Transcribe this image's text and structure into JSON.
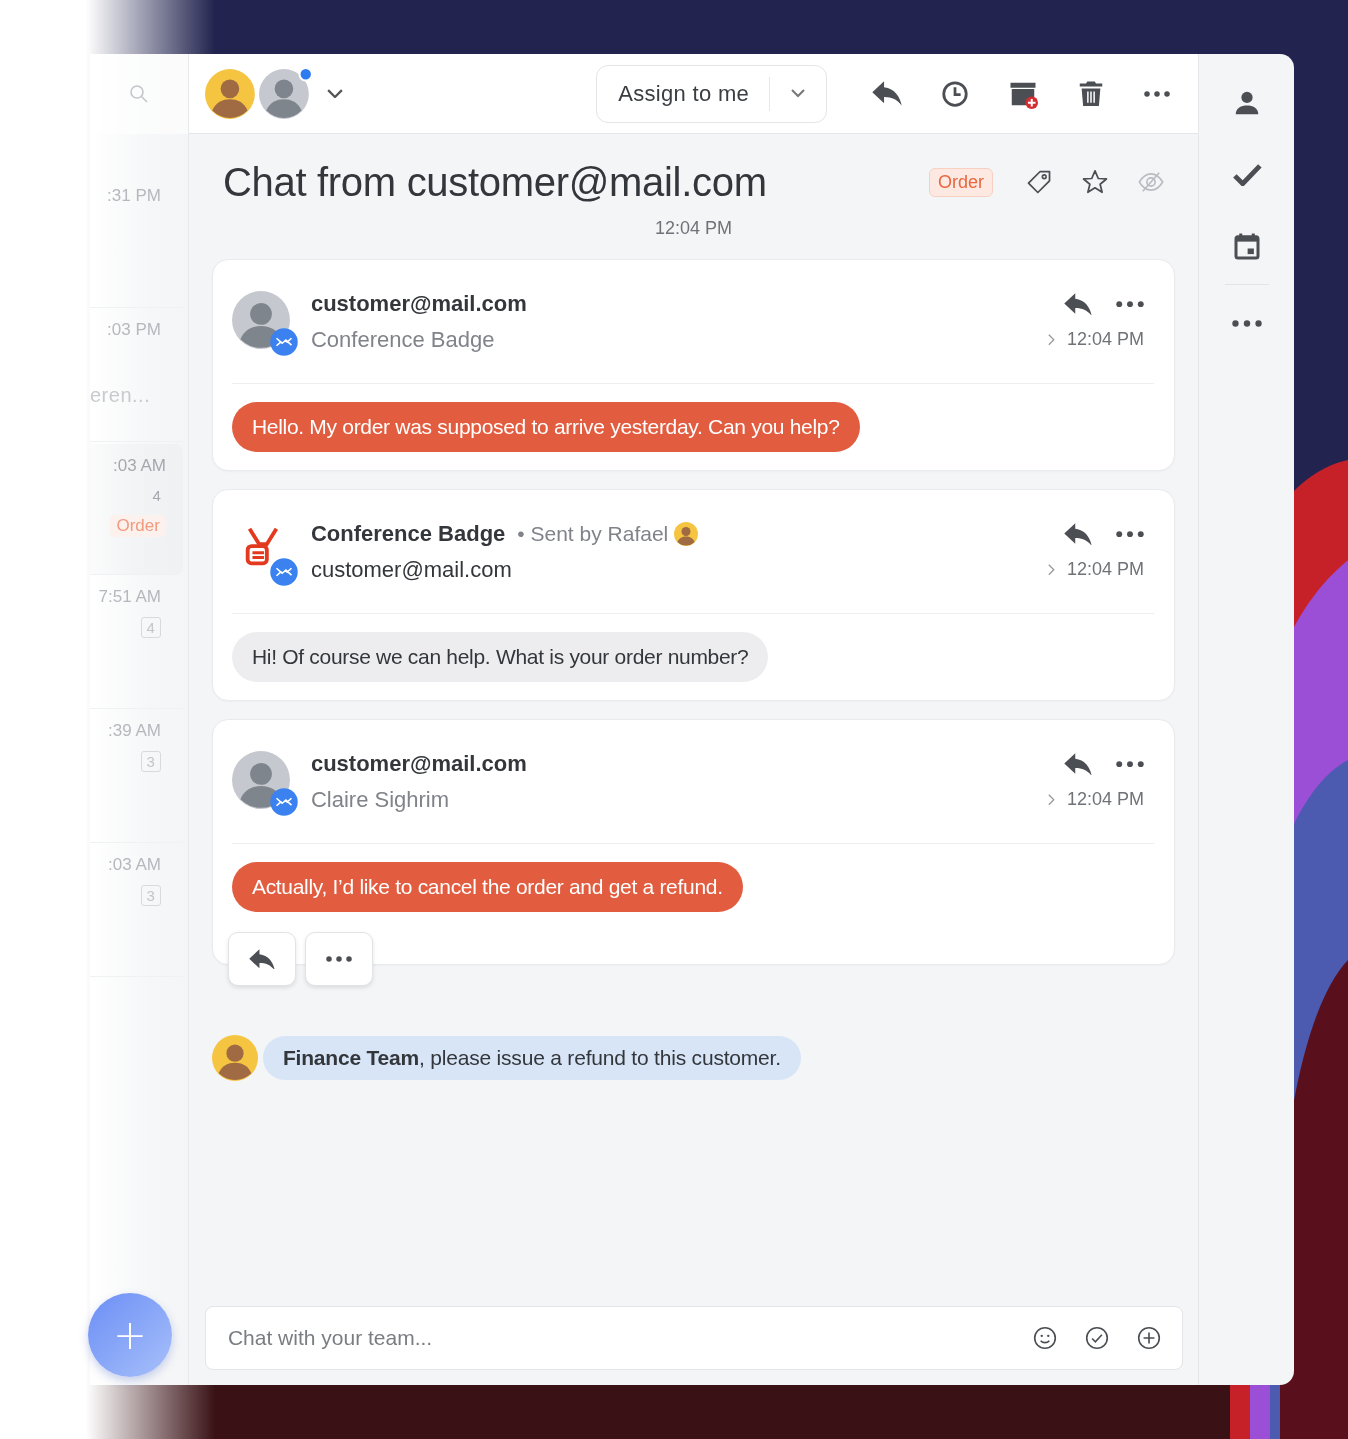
{
  "conversation_list": {
    "items": [
      {
        "time": ":31 PM",
        "selected": false
      },
      {
        "time": ":03 PM",
        "snippet": "eren...",
        "selected": false
      },
      {
        "time": ":03 AM",
        "count": "4",
        "count_boxed": false,
        "tag": "Order",
        "selected": true
      },
      {
        "time": "7:51 AM",
        "count": "4",
        "count_boxed": true,
        "selected": false
      },
      {
        "time": ":39 AM",
        "count": "3",
        "count_boxed": true,
        "selected": false
      },
      {
        "time": ":03 AM",
        "count": "3",
        "count_boxed": true,
        "selected": false
      }
    ],
    "compose_button": "+"
  },
  "toolbar": {
    "participants": [
      {
        "notified": false
      },
      {
        "notified": true
      }
    ],
    "assign_button": "Assign to me",
    "actions": [
      {
        "kind": "reply"
      },
      {
        "kind": "snooze"
      },
      {
        "kind": "archive"
      },
      {
        "kind": "delete"
      },
      {
        "kind": "more"
      }
    ]
  },
  "conversation": {
    "title": "Chat from customer@mail.com",
    "tag": "Order",
    "starred": false,
    "timestamp": "12:04 PM",
    "messages": [
      {
        "kind": "customer",
        "sender": "customer@mail.com",
        "subtitle": "Conference Badge",
        "time": "12:04 PM",
        "text": "Hello. My order was supposed to arrive yesterday. Can you help?",
        "show_actions": false
      },
      {
        "kind": "agent",
        "sender": "Conference Badge",
        "sent_by": "• Sent by Rafael",
        "subtitle": "customer@mail.com",
        "time": "12:04 PM",
        "text": "Hi! Of course we can help. What is your order number?",
        "show_actions": false
      },
      {
        "kind": "customer",
        "sender": "customer@mail.com",
        "subtitle": "Claire Sighrim",
        "time": "12:04 PM",
        "text": "Actually, I’d like to cancel the order and get a refund.",
        "show_actions": true
      }
    ],
    "note": {
      "text": "**Finance Team**, please issue a refund to this customer."
    },
    "composer": {
      "placeholder": "Chat with your team..."
    }
  },
  "right_rail": {
    "items": [
      {
        "kind": "contact"
      },
      {
        "kind": "tasks"
      },
      {
        "kind": "calendar"
      },
      {
        "kind": "more"
      }
    ]
  }
}
